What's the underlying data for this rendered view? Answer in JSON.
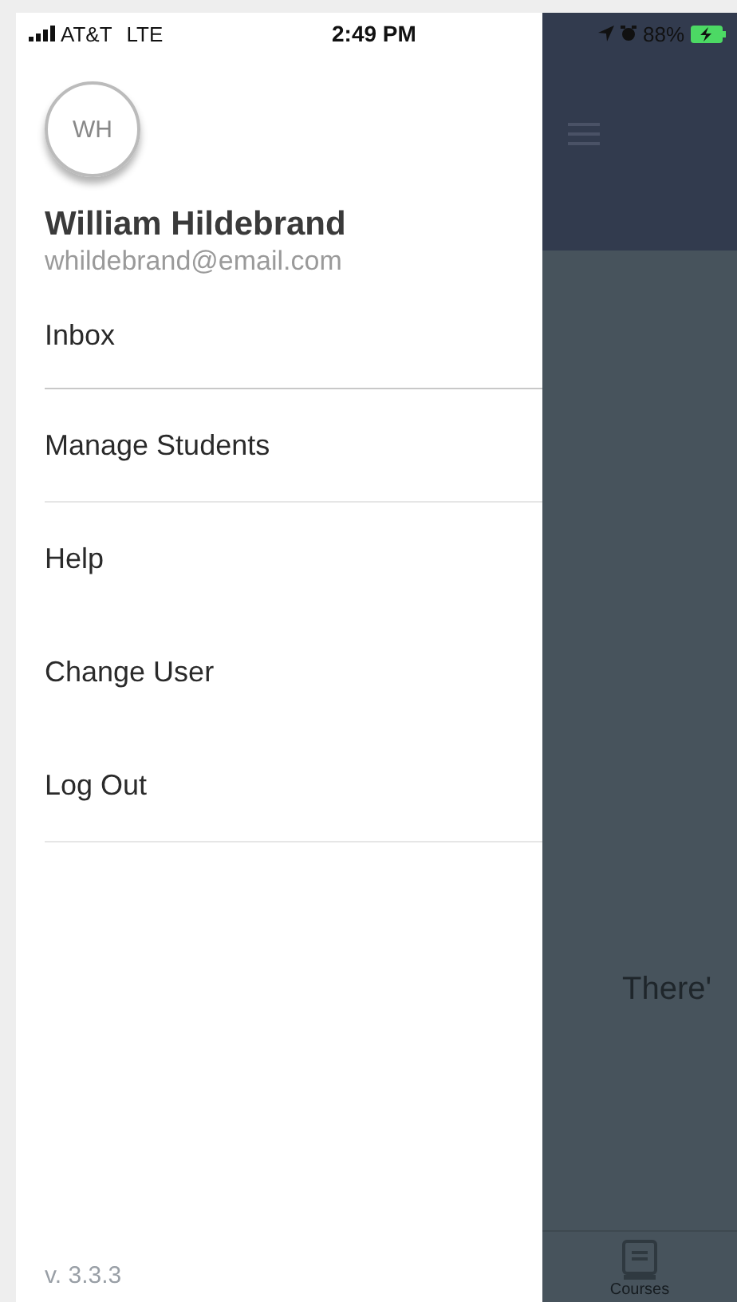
{
  "status_bar": {
    "carrier": "AT&T",
    "network": "LTE",
    "time": "2:49 PM",
    "battery": "88%"
  },
  "profile": {
    "initials": "WH",
    "name": "William Hildebrand",
    "email": "whildebrand@email.com"
  },
  "menu": [
    {
      "label": "Inbox",
      "divider": true
    },
    {
      "label": "Manage Students",
      "divider": true
    },
    {
      "label": "Help",
      "divider": false
    },
    {
      "label": "Change User",
      "divider": false
    },
    {
      "label": "Log Out",
      "divider": true
    }
  ],
  "version": "v. 3.3.3",
  "background": {
    "empty_message": "There'",
    "tab": "Courses"
  }
}
